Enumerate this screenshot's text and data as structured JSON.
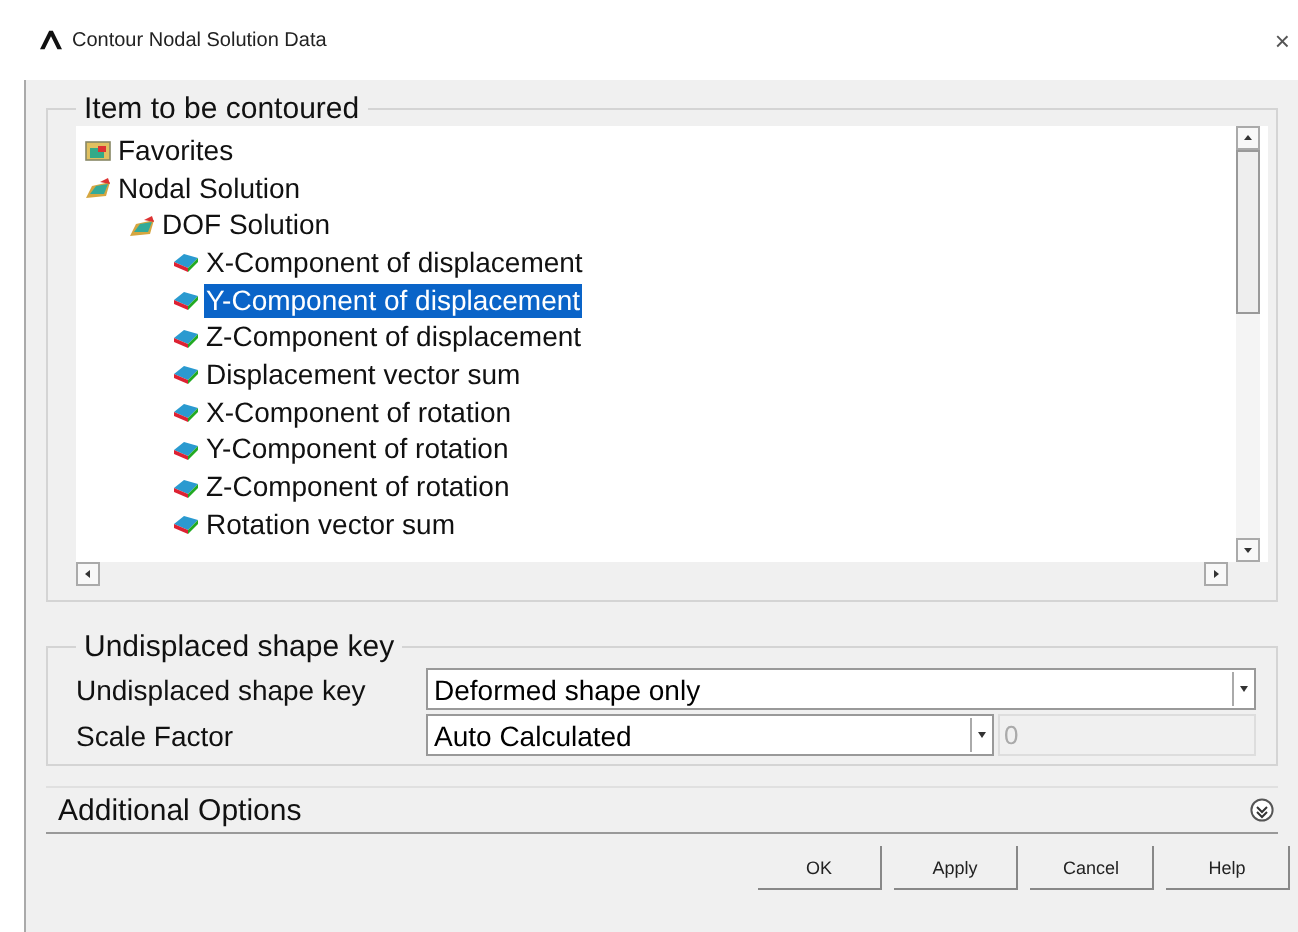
{
  "window": {
    "title": "Contour Nodal Solution Data",
    "close": "×"
  },
  "item_group": {
    "title": "Item to be contoured",
    "tree": [
      {
        "label": "Favorites",
        "kind": "favorites",
        "selected": false
      },
      {
        "label": "Nodal Solution",
        "kind": "folder",
        "selected": false,
        "children": [
          {
            "label": "DOF Solution",
            "kind": "folder",
            "selected": false,
            "children": [
              {
                "label": "X-Component of displacement",
                "kind": "result",
                "selected": false
              },
              {
                "label": "Y-Component of displacement",
                "kind": "result",
                "selected": true
              },
              {
                "label": "Z-Component of displacement",
                "kind": "result",
                "selected": false
              },
              {
                "label": "Displacement vector sum",
                "kind": "result",
                "selected": false
              },
              {
                "label": "X-Component of rotation",
                "kind": "result",
                "selected": false
              },
              {
                "label": "Y-Component of rotation",
                "kind": "result",
                "selected": false
              },
              {
                "label": "Z-Component of rotation",
                "kind": "result",
                "selected": false
              },
              {
                "label": "Rotation vector sum",
                "kind": "result",
                "selected": false
              }
            ]
          }
        ]
      }
    ]
  },
  "shape_group": {
    "title": "Undisplaced shape key",
    "fields": [
      {
        "label": "Undisplaced shape key",
        "value": "Deformed shape only"
      },
      {
        "label": "Scale Factor",
        "value": "Auto Calculated",
        "extra_value": "0"
      }
    ]
  },
  "additional_options": {
    "label": "Additional Options",
    "expanded": false
  },
  "buttons": [
    "OK",
    "Apply",
    "Cancel",
    "Help"
  ]
}
